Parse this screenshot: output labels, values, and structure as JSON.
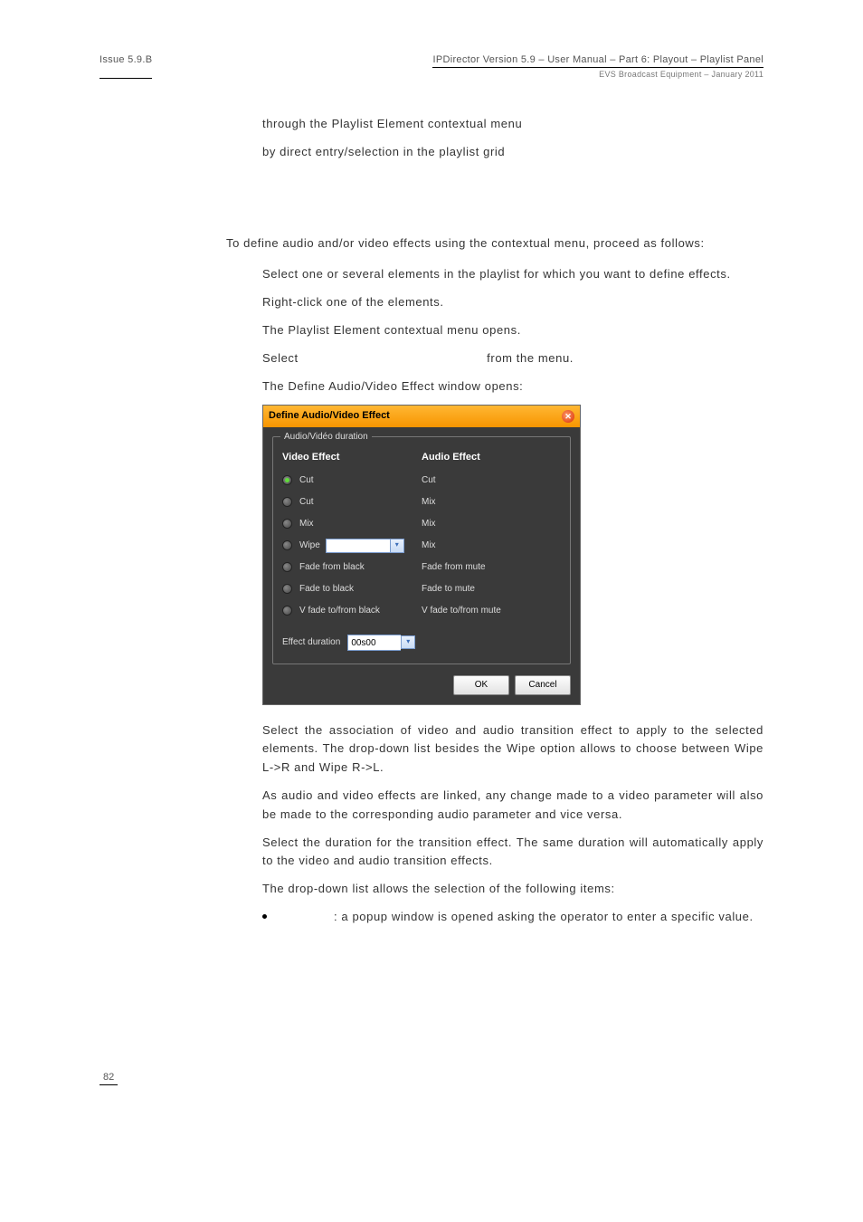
{
  "header": {
    "left": "Issue 5.9.B",
    "right_line1": "IPDirector Version 5.9 – User Manual – Part 6: Playout – Playlist Panel",
    "right_line2": "EVS Broadcast Equipment – January 2011"
  },
  "intro_lines": [
    "through the Playlist Element contextual menu",
    "by direct entry/selection in the playlist grid"
  ],
  "para_define": "To define audio and/or video effects using the contextual menu, proceed as follows:",
  "step1": "Select one or several elements in the playlist for which you want to define effects.",
  "step2a": "Right-click one of the elements.",
  "step2b": "The Playlist Element contextual menu opens.",
  "step3a_pre": "Select",
  "step3a_post": "from the menu.",
  "step3b": "The Define Audio/Video Effect window opens:",
  "dialog": {
    "title": "Define Audio/Video Effect",
    "legend": "Audio/Vidéo duration",
    "video_header": "Video Effect",
    "audio_header": "Audio Effect",
    "rows": [
      {
        "video": "Cut",
        "audio": "Cut",
        "selected": true
      },
      {
        "video": "Cut",
        "audio": "Mix",
        "selected": false
      },
      {
        "video": "Mix",
        "audio": "Mix",
        "selected": false
      },
      {
        "video": "Wipe",
        "audio": "Mix",
        "selected": false,
        "has_dropdown": true
      },
      {
        "video": "Fade from black",
        "audio": "Fade from mute",
        "selected": false
      },
      {
        "video": "Fade to black",
        "audio": "Fade to mute",
        "selected": false
      },
      {
        "video": "V fade to/from black",
        "audio": "V fade to/from mute",
        "selected": false
      }
    ],
    "effect_duration_label": "Effect duration",
    "effect_duration_value": "00s00",
    "ok": "OK",
    "cancel": "Cancel"
  },
  "para_assoc": "Select the association of video and audio transition effect to apply to the selected elements. The drop-down list besides the Wipe option allows to choose between Wipe L->R and Wipe R->L.",
  "para_linked": "As audio and video effects are linked, any change made to a video parameter will also be made to the corresponding audio parameter and vice versa.",
  "para_duration": "Select the duration for the transition effect. The same duration will automatically apply to the video and audio transition effects.",
  "para_ddlist": "The drop-down list allows the selection of the following items:",
  "bullet1": ": a popup window is opened asking the operator to enter a specific value.",
  "page_number": "82"
}
